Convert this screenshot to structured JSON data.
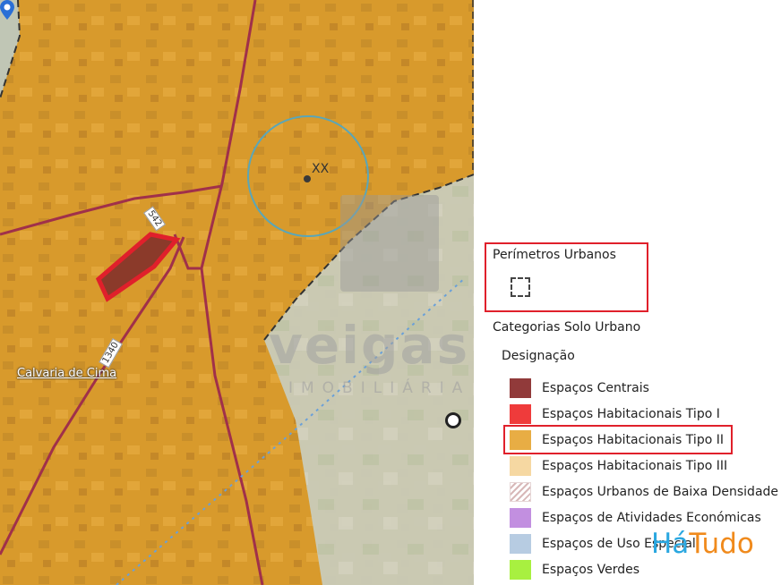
{
  "map": {
    "place_label": "Calvaria de Cima",
    "marker_label": "XX",
    "road_labels": [
      "542",
      "1340"
    ],
    "watermark": {
      "brand": "veigas",
      "subtitle": "IMOBILIÁRIA"
    },
    "colors": {
      "habitacional_tipo_ii": "#e3a33a",
      "rural_area": "#c9cfc4",
      "road": "#a0304a",
      "parcel_highlight": "#e0202b",
      "parcel_fill": "#8b3a2a",
      "buffer_circle": "#5aa6b8",
      "dotted_line": "#6aa0d8"
    },
    "icons": [
      "location-pin-icon",
      "circle-marker-icon",
      "veigas-logo-icon"
    ]
  },
  "legend": {
    "perimetros_title": "Perímetros Urbanos",
    "categorias_title": "Categorias Solo Urbano",
    "designacao_title": "Designação",
    "items": [
      {
        "label": "Espaços Centrais",
        "color": "#913a3a"
      },
      {
        "label": "Espaços Habitacionais Tipo I",
        "color": "#ef3b3b"
      },
      {
        "label": "Espaços Habitacionais Tipo II",
        "color": "#e8ad44"
      },
      {
        "label": "Espaços Habitacionais Tipo III",
        "color": "#f6d8a2"
      },
      {
        "label": "Espaços Urbanos de Baixa Densidade",
        "color": "hatched"
      },
      {
        "label": "Espaços de Atividades Económicas",
        "color": "#c28fe0"
      },
      {
        "label": "Espaços de Uso Especial",
        "color": "#b7cce2"
      },
      {
        "label": "Espaços Verdes",
        "color": "#a8f040"
      }
    ]
  },
  "branding": {
    "hatudo_ha": "Há",
    "hatudo_tudo": "Tudo"
  }
}
